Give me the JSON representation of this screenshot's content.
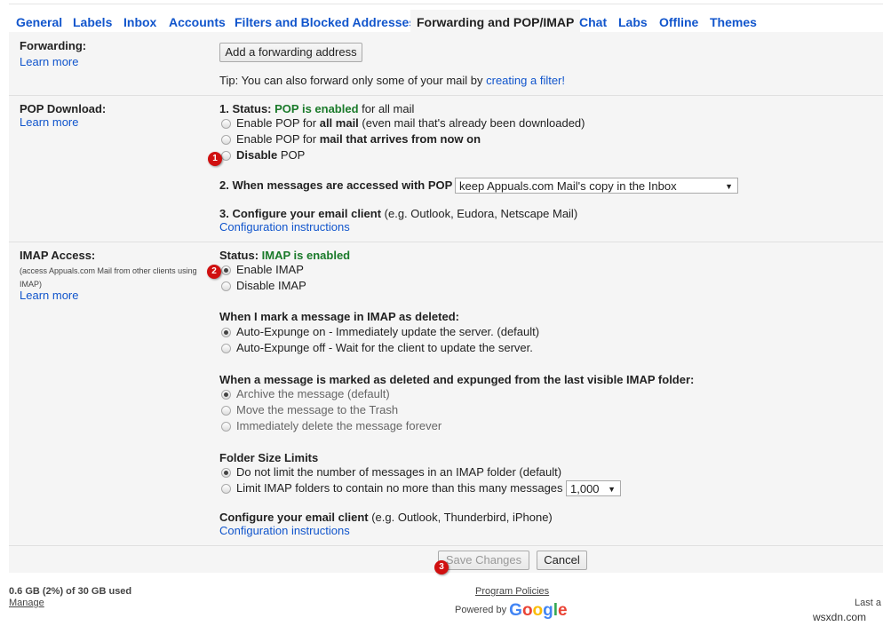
{
  "tabs": [
    "General",
    "Labels",
    "Inbox",
    "Accounts",
    "Filters and Blocked Addresses",
    "Forwarding and POP/IMAP",
    "Chat",
    "Labs",
    "Offline",
    "Themes"
  ],
  "active_tab": "Forwarding and POP/IMAP",
  "forwarding": {
    "label": "Forwarding:",
    "learn_more": "Learn more",
    "add_button": "Add a forwarding address",
    "tip_prefix": "Tip: You can also forward only some of your mail by ",
    "tip_link": "creating a filter!"
  },
  "pop": {
    "label": "POP Download:",
    "learn_more": "Learn more",
    "status_prefix": "1. Status: ",
    "status_value": "POP is enabled",
    "status_suffix": " for all mail",
    "options": [
      {
        "pre": "Enable POP for ",
        "bold": "all mail",
        "post": " (even mail that's already been downloaded)",
        "selected": false
      },
      {
        "pre": "Enable POP for ",
        "bold": "mail that arrives from now on",
        "post": "",
        "selected": false
      },
      {
        "pre": "",
        "bold": "Disable",
        "post": " POP",
        "selected": false
      }
    ],
    "access_label": "2. When messages are accessed with POP",
    "access_select": "keep Appuals.com Mail's copy in the Inbox",
    "configure_label": "3. Configure your email client",
    "configure_hint": " (e.g. Outlook, Eudora, Netscape Mail)",
    "config_link": "Configuration instructions"
  },
  "imap": {
    "label": "IMAP Access:",
    "sub1": "(access Appuals.com Mail from other clients using",
    "sub2": "IMAP)",
    "learn_more": "Learn more",
    "status_prefix": "Status: ",
    "status_value": "IMAP is enabled",
    "enable": "Enable IMAP",
    "disable": "Disable IMAP",
    "enabled": true,
    "deleted_heading": "When I mark a message in IMAP as deleted:",
    "deleted_options": [
      {
        "label": "Auto-Expunge on - Immediately update the server. (default)",
        "selected": true
      },
      {
        "label": "Auto-Expunge off - Wait for the client to update the server.",
        "selected": false
      }
    ],
    "expunged_heading": "When a message is marked as deleted and expunged from the last visible IMAP folder:",
    "expunged_options": [
      {
        "label": "Archive the message (default)",
        "selected": true
      },
      {
        "label": "Move the message to the Trash",
        "selected": false
      },
      {
        "label": "Immediately delete the message forever",
        "selected": false
      }
    ],
    "folder_heading": "Folder Size Limits",
    "folder_options": [
      {
        "label": "Do not limit the number of messages in an IMAP folder (default)",
        "selected": true
      },
      {
        "label": "Limit IMAP folders to contain no more than this many messages",
        "selected": false
      }
    ],
    "folder_limit": "1,000",
    "configure_label": "Configure your email client",
    "configure_hint": " (e.g. Outlook, Thunderbird, iPhone)",
    "config_link": "Configuration instructions"
  },
  "actions": {
    "save": "Save Changes",
    "cancel": "Cancel"
  },
  "badges": [
    "1",
    "2",
    "3"
  ],
  "footer": {
    "usage": "0.6 GB (2%) of 30 GB used",
    "manage": "Manage",
    "policies": "Program Policies",
    "powered_by": "Powered by",
    "google": "Google",
    "last": "Last a"
  },
  "watermark": "wsxdn.com",
  "colors": {
    "link": "#1155cc",
    "status_green": "#1a7a2a",
    "badge": "#d01010"
  }
}
